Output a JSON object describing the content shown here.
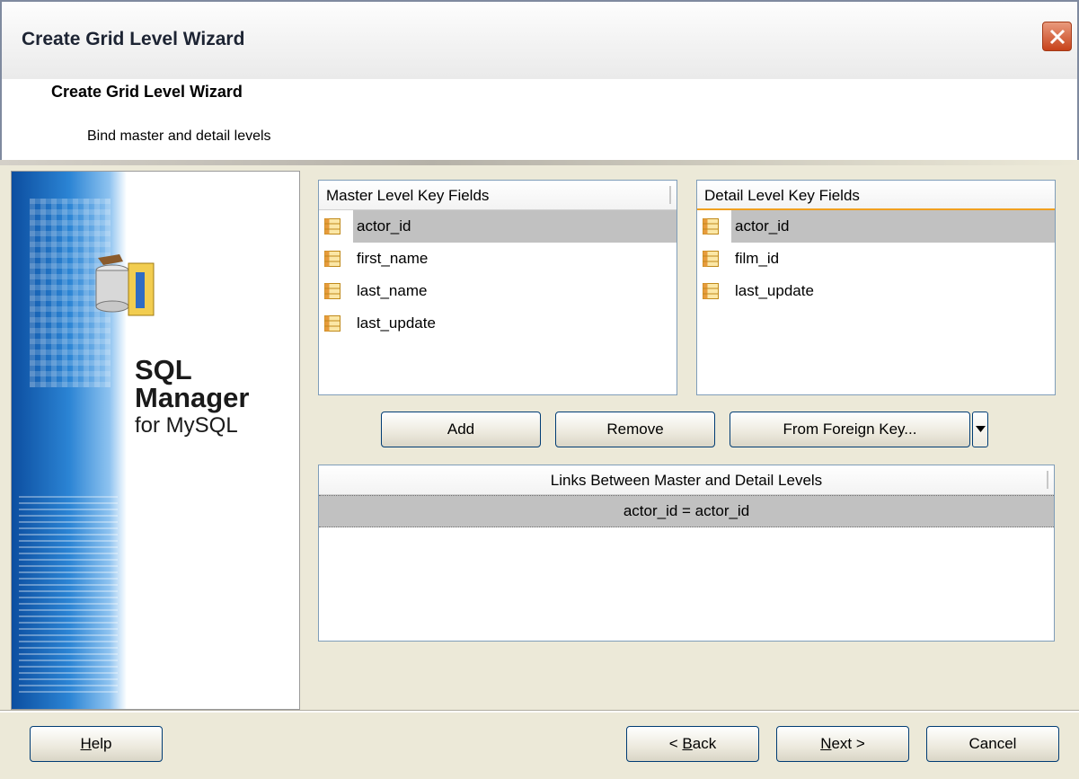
{
  "window": {
    "title": "Create Grid Level Wizard"
  },
  "header": {
    "title": "Create Grid Level Wizard",
    "subtitle": "Bind master and detail levels"
  },
  "logo": {
    "line1": "SQL",
    "line2": "Manager",
    "line3": "for MySQL"
  },
  "master": {
    "header": "Master Level Key Fields",
    "items": [
      "actor_id",
      "first_name",
      "last_name",
      "last_update"
    ],
    "selected": "actor_id"
  },
  "detail": {
    "header": "Detail Level Key Fields",
    "items": [
      "actor_id",
      "film_id",
      "last_update"
    ],
    "selected": "actor_id"
  },
  "actions": {
    "add": "Add",
    "remove": "Remove",
    "from_fk": "From Foreign Key..."
  },
  "links": {
    "header": "Links Between Master and Detail Levels",
    "rows": [
      "actor_id = actor_id"
    ]
  },
  "footer": {
    "help_first": "H",
    "help_rest": "elp",
    "back_prefix": "< ",
    "back_first": "B",
    "back_rest": "ack",
    "next_first": "N",
    "next_rest": "ext >",
    "cancel": "Cancel"
  },
  "colors": {
    "selection": "#c1c1c1",
    "accent": "#003c74",
    "close": "#c7421a"
  }
}
